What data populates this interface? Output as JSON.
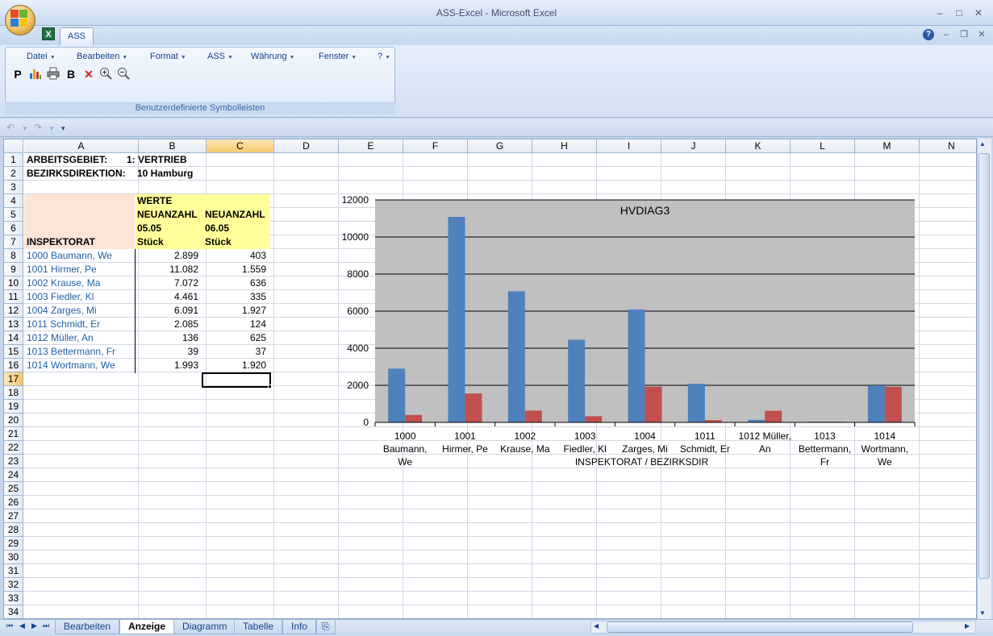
{
  "window": {
    "title": "ASS-Excel  -  Microsoft Excel",
    "tab": "ASS",
    "help": "?"
  },
  "menus": [
    "Datei",
    "Bearbeiten",
    "Format",
    "ASS",
    "Währung",
    "Fenster",
    "?"
  ],
  "toolbar": {
    "p_label": "P",
    "b_label": "B",
    "group_label": "Benutzerdefinierte Symbolleisten"
  },
  "columns": [
    "A",
    "B",
    "C",
    "D",
    "E",
    "F",
    "G",
    "H",
    "I",
    "J",
    "K",
    "L",
    "M",
    "N"
  ],
  "sheet": {
    "a1": "ARBEITSGEBIET:",
    "b1": "1: VERTRIEB",
    "a2": "BEZIRKSDIREKTION:",
    "b2": "10 Hamburg",
    "b4": "WERTE",
    "b5": "NEUANZAHL",
    "c5": "NEUANZAHL",
    "b6": "05.05",
    "c6": "06.05",
    "a7": "INSPEKTORAT",
    "b7": "Stück",
    "c7": "Stück",
    "rows": [
      {
        "name": "1000 Baumann, We",
        "v1": "2.899",
        "v2": "403"
      },
      {
        "name": "1001 Hirmer, Pe",
        "v1": "11.082",
        "v2": "1.559"
      },
      {
        "name": "1002 Krause, Ma",
        "v1": "7.072",
        "v2": "636"
      },
      {
        "name": "1003 Fiedler, Kl",
        "v1": "4.461",
        "v2": "335"
      },
      {
        "name": "1004 Zarges, Mi",
        "v1": "6.091",
        "v2": "1.927"
      },
      {
        "name": "1011 Schmidt, Er",
        "v1": "2.085",
        "v2": "124"
      },
      {
        "name": "1012 Müller, An",
        "v1": "136",
        "v2": "625"
      },
      {
        "name": "1013 Bettermann, Fr",
        "v1": "39",
        "v2": "37"
      },
      {
        "name": "1014 Wortmann, We",
        "v1": "1.993",
        "v2": "1.920"
      }
    ]
  },
  "chart_data": {
    "type": "bar",
    "title": "HVDIAG3",
    "xlabel": "INSPEKTORAT  / BEZIRKSDIR",
    "ylabel": "",
    "ylim": [
      0,
      12000
    ],
    "yticks": [
      "0",
      "2000",
      "4000",
      "6000",
      "8000",
      "10000",
      "12000"
    ],
    "grid": true,
    "categories": [
      [
        "1000",
        "Baumann,",
        "We"
      ],
      [
        "1001",
        "Hirmer, Pe"
      ],
      [
        "1002",
        "Krause, Ma"
      ],
      [
        "1003",
        "Fiedler, Kl"
      ],
      [
        "1004",
        "Zarges, Mi"
      ],
      [
        "1011",
        "Schmidt, Er"
      ],
      [
        "1012 Müller,",
        "An"
      ],
      [
        "1013",
        "Bettermann,",
        "Fr"
      ],
      [
        "1014",
        "Wortmann,",
        "We"
      ]
    ],
    "series": [
      {
        "values": [
          2899,
          11082,
          7072,
          4461,
          6091,
          2085,
          136,
          39,
          1993
        ],
        "color": "#4f81bd"
      },
      {
        "values": [
          403,
          1559,
          636,
          335,
          1927,
          124,
          625,
          37,
          1920
        ],
        "color": "#c0504d"
      }
    ],
    "plot_bg": "#c0c0c0"
  },
  "sheet_tabs": [
    "Bearbeiten",
    "Anzeige",
    "Diagramm",
    "Tabelle",
    "Info"
  ],
  "active_tab": "Anzeige",
  "rownums": [
    "1",
    "2",
    "3",
    "4",
    "5",
    "6",
    "7",
    "8",
    "9",
    "10",
    "11",
    "12",
    "13",
    "14",
    "15",
    "16",
    "17",
    "18",
    "19",
    "20",
    "21",
    "22",
    "23",
    "24",
    "25",
    "26",
    "27",
    "28",
    "29",
    "30",
    "31",
    "32",
    "33",
    "34"
  ]
}
